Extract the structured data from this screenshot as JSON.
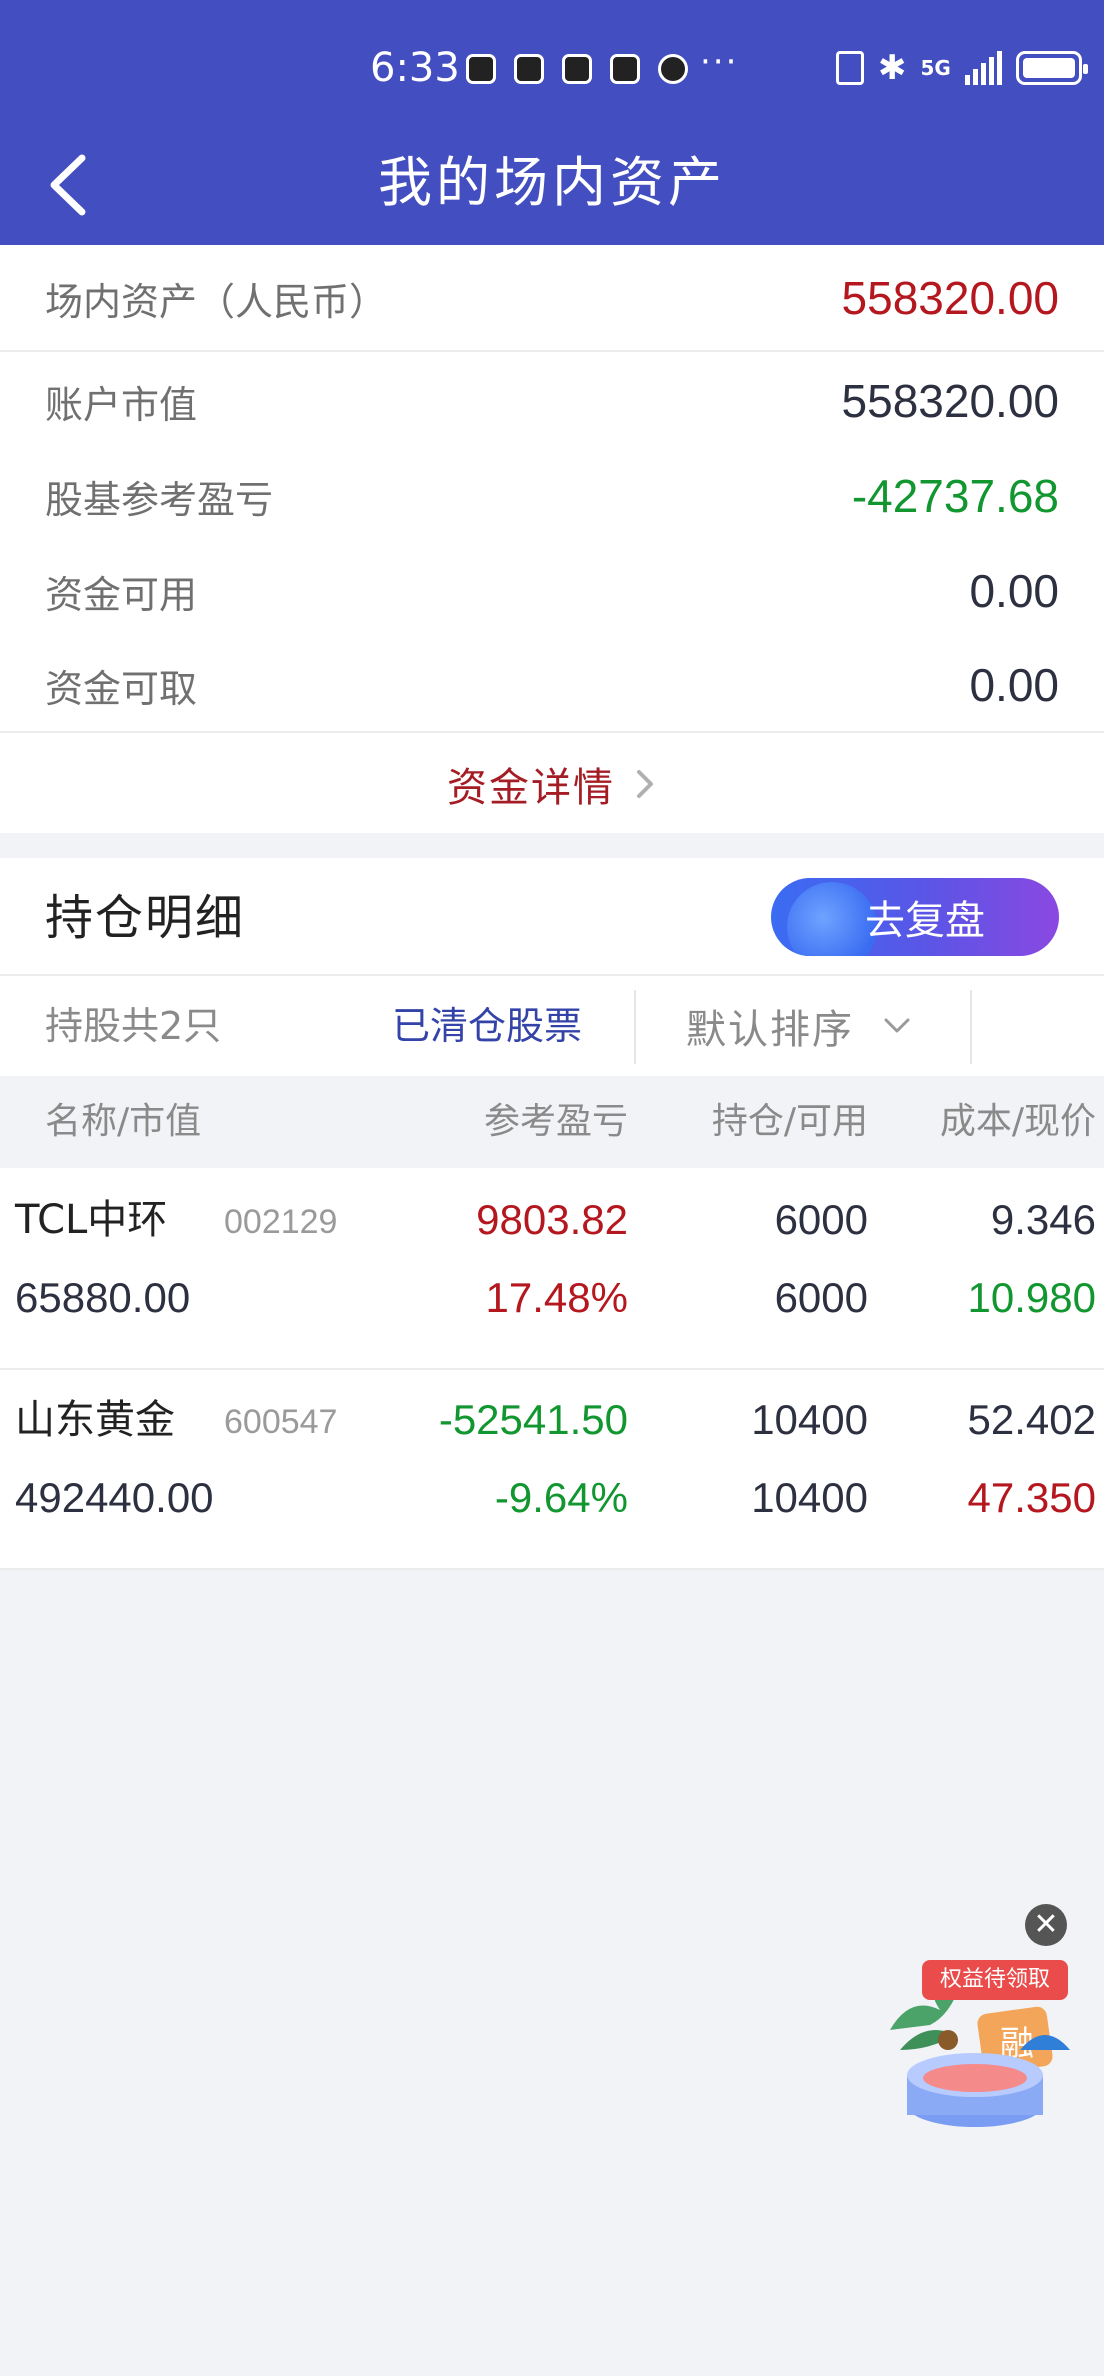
{
  "status_bar": {
    "time": "6:33",
    "more": "···",
    "network": "5G"
  },
  "header": {
    "title": "我的场内资产"
  },
  "assets": {
    "total_label": "场内资产（人民币）",
    "total_value": "558320.00",
    "rows": [
      {
        "label": "账户市值",
        "value": "558320.00"
      },
      {
        "label": "股基参考盈亏",
        "value": "-42737.68"
      },
      {
        "label": "资金可用",
        "value": "0.00"
      },
      {
        "label": "资金可取",
        "value": "0.00"
      }
    ],
    "detail_link": "资金详情"
  },
  "holdings": {
    "title": "持仓明细",
    "review_button": "去复盘",
    "count_text": "持股共2只",
    "cleared_link": "已清仓股票",
    "sort_label": "默认排序",
    "columns": [
      "名称/市值",
      "参考盈亏",
      "持仓/可用",
      "成本/现价"
    ],
    "stocks": [
      {
        "name": "TCL中环",
        "code": "002129",
        "market_value": "65880.00",
        "pnl": "9803.82",
        "pnl_pct": "17.48%",
        "position": "6000",
        "available": "6000",
        "cost": "9.346",
        "price": "10.980"
      },
      {
        "name": "山东黄金",
        "code": "600547",
        "market_value": "492440.00",
        "pnl": "-52541.50",
        "pnl_pct": "-9.64%",
        "position": "10400",
        "available": "10400",
        "cost": "52.402",
        "price": "47.350"
      }
    ]
  },
  "promo": {
    "tag": "权益待领取",
    "badge": "融"
  },
  "colors": {
    "header_bg": "#434ec0",
    "up_red": "#b5171e",
    "down_green": "#12962f",
    "link_blue": "#3443a8"
  }
}
